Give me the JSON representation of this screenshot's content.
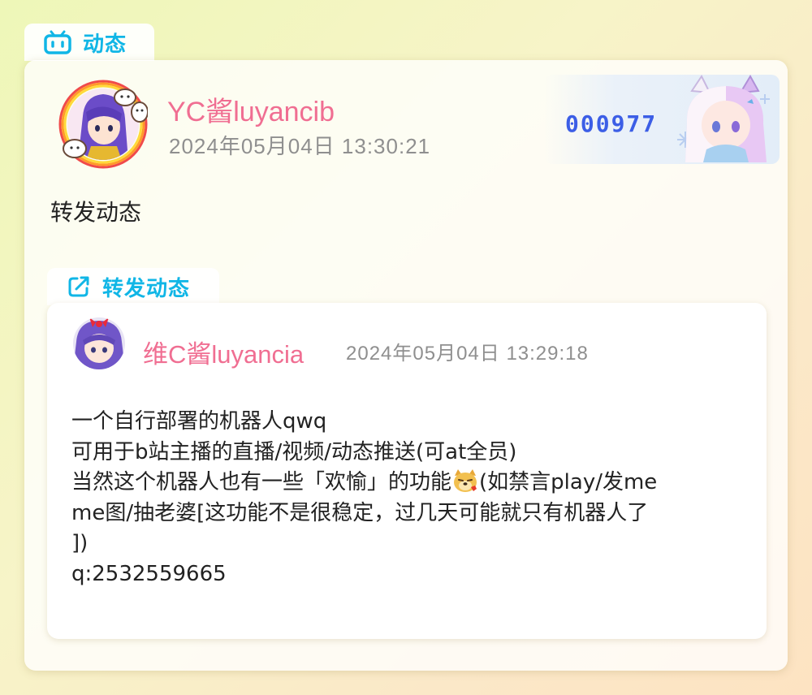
{
  "header": {
    "tab_label": "动态",
    "tab_icon": "bilibili-tv-icon"
  },
  "post": {
    "username": "YC酱luyancib",
    "timestamp": "2024年05月04日 13:30:21",
    "content": "转发动态",
    "fan_badge_number": "000977"
  },
  "repost": {
    "tab_label": "转发动态",
    "tab_icon": "share-icon",
    "username": "维C酱luyancia",
    "timestamp": "2024年05月04日 13:29:18",
    "lines": [
      "一个自行部署的机器人qwq",
      "可用于b站主播的直播/视频/动态推送(可at全员)",
      "当然这个机器人也有一些「欢愉」的功能",
      "me图/抽老婆[这功能不是很稳定，过几天可能就只有机器人了",
      "])",
      "q:2532559665"
    ],
    "line3_after_emoji": "(如禁言play/发me",
    "emoji_name": "doge-emoji-icon"
  },
  "colors": {
    "accent": "#10b6e6",
    "username": "#f06e92",
    "timestamp": "#8f8f8f",
    "fan_number": "#3c5ee6"
  }
}
